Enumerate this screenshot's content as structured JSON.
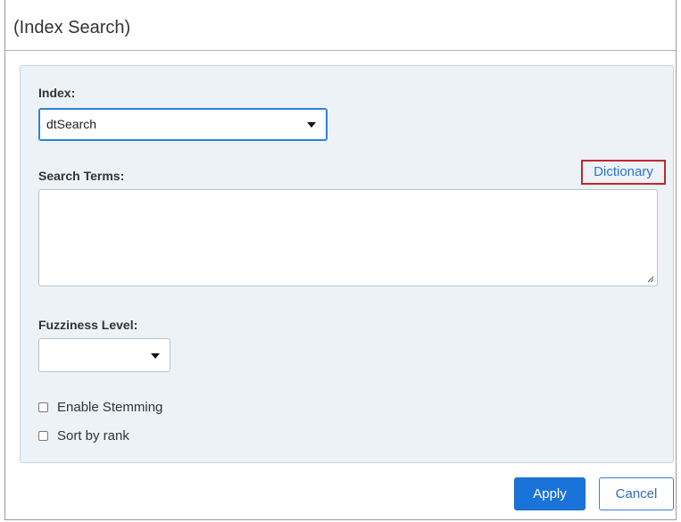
{
  "dialog": {
    "title": "(Index Search)"
  },
  "index": {
    "label": "Index:",
    "selected": "dtSearch"
  },
  "search_terms": {
    "label": "Search Terms:",
    "value": "",
    "dictionary_link": "Dictionary"
  },
  "fuzziness": {
    "label": "Fuzziness Level:",
    "selected": ""
  },
  "options": [
    {
      "label": "Enable Stemming",
      "checked": false
    },
    {
      "label": "Sort by rank",
      "checked": false
    }
  ],
  "buttons": {
    "apply": "Apply",
    "cancel": "Cancel"
  },
  "colors": {
    "accent": "#1a73d9",
    "panel_bg": "#edf2f7",
    "highlight_border": "#c0282d",
    "link": "#2b72c9"
  }
}
